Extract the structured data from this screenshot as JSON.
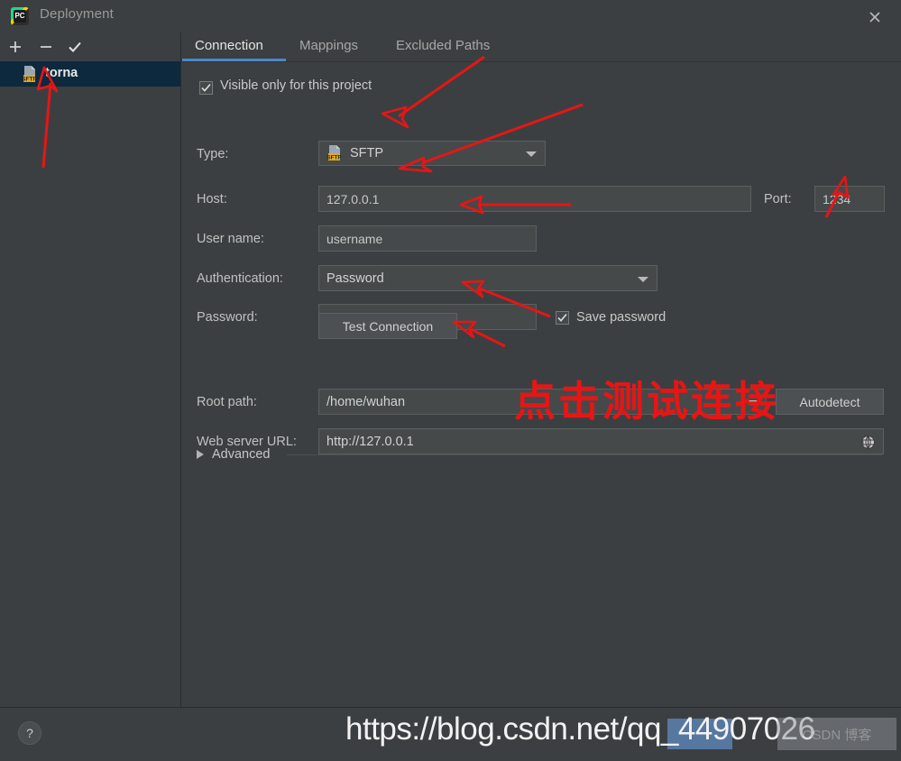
{
  "window": {
    "title": "Deployment",
    "app_icon": "pycharm-icon",
    "close_label": "✕"
  },
  "sidebar": {
    "toolbar": [
      {
        "name": "add",
        "icon": "plus-icon",
        "label": "+"
      },
      {
        "name": "remove",
        "icon": "minus-icon",
        "label": "−"
      },
      {
        "name": "set-default",
        "icon": "check-icon",
        "label": "✓"
      }
    ],
    "items": [
      {
        "label": "torna",
        "icon": "sftp-server-icon",
        "selected": true
      }
    ]
  },
  "main": {
    "tabs": [
      {
        "label": "Connection",
        "active": true
      },
      {
        "label": "Mappings",
        "active": false
      },
      {
        "label": "Excluded Paths",
        "active": false
      }
    ],
    "visible_only": {
      "label": "Visible only for this project",
      "checked": true
    },
    "fields": {
      "type": {
        "label": "Type:",
        "value": "SFTP",
        "icon": "sftp-icon"
      },
      "host": {
        "label": "Host:",
        "value": "127.0.0.1"
      },
      "port": {
        "label": "Port:",
        "value": "1234"
      },
      "username": {
        "label": "User name:",
        "value": "username"
      },
      "authentication": {
        "label": "Authentication:",
        "value": "Password"
      },
      "password": {
        "label": "Password:",
        "value": "••••••"
      },
      "save_password": {
        "label": "Save password",
        "checked": true
      },
      "root_path": {
        "label": "Root path:",
        "value": "/home/wuhan"
      },
      "web_server_url": {
        "label": "Web server URL:",
        "value": "http://127.0.0.1",
        "icon": "globe-icon"
      }
    },
    "buttons": {
      "test_connection": "Test Connection",
      "autodetect": "Autodetect"
    },
    "advanced": {
      "label": "Advanced",
      "expanded": false
    }
  },
  "footer": {
    "help_label": "?",
    "watermark": "https://blog.csdn.net/qq_44907026",
    "watermark_badge": "CSDN 博客"
  },
  "annotations": {
    "chinese_note": "点击测试连接",
    "accent_color": "#e81515",
    "arrows": 6
  },
  "colors": {
    "background": "#3c3f41",
    "field_bg": "#45494a",
    "selection": "#0d293e",
    "tab_accent": "#4a88c7",
    "annotation_red": "#e81515"
  }
}
